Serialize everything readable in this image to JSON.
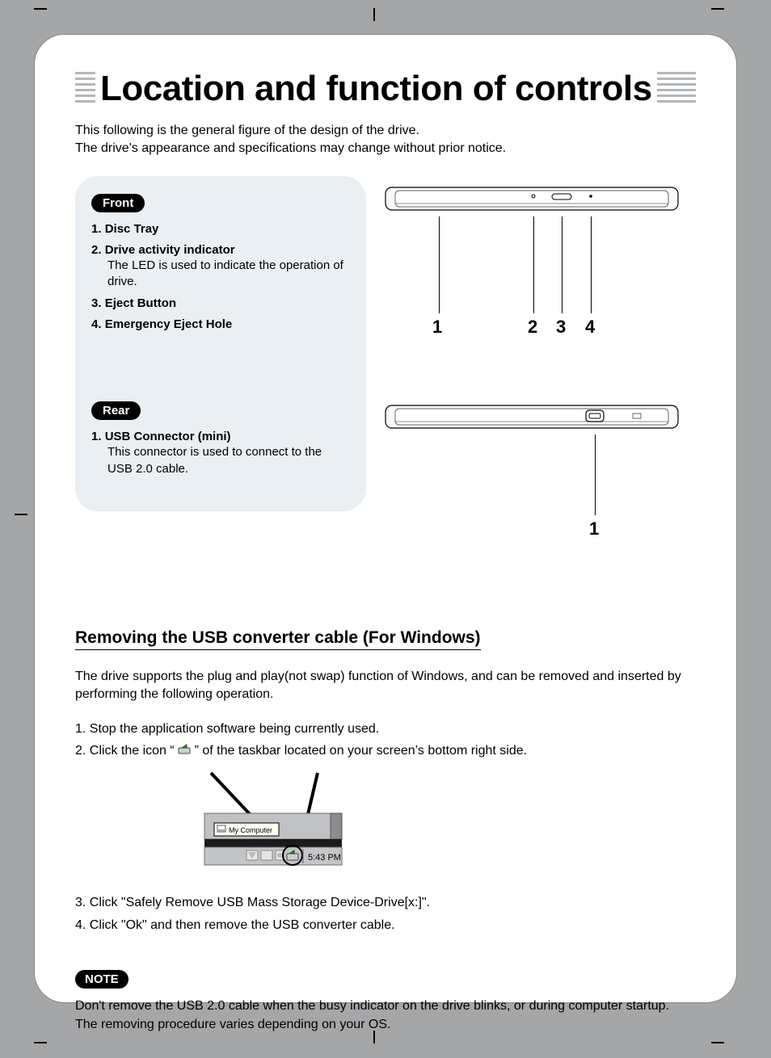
{
  "title": "Location and function of controls",
  "intro_line1": "This following is the general figure of the design of the drive.",
  "intro_line2": "The drive's appearance and specifications may change without prior notice.",
  "front": {
    "label": "Front",
    "items": [
      {
        "num": "1.",
        "title": "Disc Tray"
      },
      {
        "num": "2.",
        "title": "Drive activity indicator",
        "desc": "The LED is used to indicate the operation of drive."
      },
      {
        "num": "3.",
        "title": "Eject Button"
      },
      {
        "num": "4.",
        "title": "Emergency Eject Hole"
      }
    ],
    "callouts": [
      "1",
      "2",
      "3",
      "4"
    ]
  },
  "rear": {
    "label": "Rear",
    "items": [
      {
        "num": "1.",
        "title": "USB Connector (mini)",
        "desc": "This connector is used to connect to the USB 2.0 cable."
      }
    ],
    "callouts": [
      "1"
    ]
  },
  "removing": {
    "heading": "Removing the USB converter cable (For Windows)",
    "intro": "The drive supports the plug and play(not swap) function of Windows, and can be removed and inserted by performing the following operation.",
    "steps": [
      "1. Stop the application software being currently used.",
      "2. Click the icon \"      \" of the taskbar located on your screen's bottom right side.",
      "3. Click \"Safely Remove USB Mass Storage Device-Drive[x:]\".",
      "4. Click \"Ok\" and then remove the USB converter cable."
    ],
    "taskbar": {
      "tooltip": "My Computer",
      "clock": "5:43 PM"
    }
  },
  "note": {
    "label": "NOTE",
    "line1": "Don't remove the USB 2.0 cable when the busy indicator on the drive blinks, or during computer startup.",
    "line2": "The removing procedure varies depending on your OS."
  }
}
